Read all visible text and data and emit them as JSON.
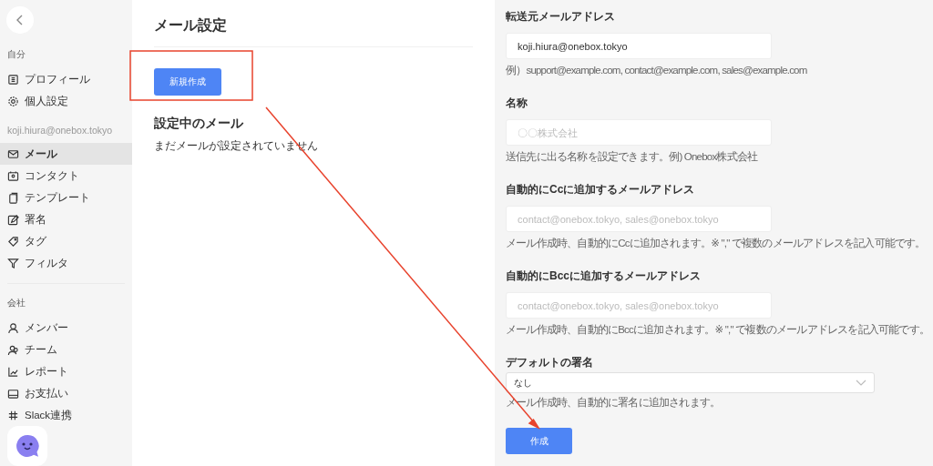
{
  "sidebar": {
    "sections": [
      {
        "heading": "自分",
        "items": [
          {
            "label": "プロフィール",
            "selected": false
          },
          {
            "label": "個人設定",
            "selected": false
          }
        ]
      },
      {
        "heading": "koji.hiura@onebox.tokyo",
        "items": [
          {
            "label": "メール",
            "selected": true
          },
          {
            "label": "コンタクト",
            "selected": false
          },
          {
            "label": "テンプレート",
            "selected": false
          },
          {
            "label": "署名",
            "selected": false
          },
          {
            "label": "タグ",
            "selected": false
          },
          {
            "label": "フィルタ",
            "selected": false
          }
        ]
      },
      {
        "heading": "会社",
        "items": [
          {
            "label": "メンバー",
            "selected": false
          },
          {
            "label": "チーム",
            "selected": false
          },
          {
            "label": "レポート",
            "selected": false
          },
          {
            "label": "お支払い",
            "selected": false
          },
          {
            "label": "Slack連携",
            "selected": false
          }
        ]
      }
    ]
  },
  "main": {
    "title": "メール設定",
    "new_button": "新規作成",
    "section_title": "設定中のメール",
    "empty_message": "まだメールが設定されていません"
  },
  "form": {
    "fields": [
      {
        "kind": "input",
        "label": "転送元メールアドレス",
        "value": "koji.hiura@onebox.tokyo",
        "hint": "例）support@example.com, contact@example.com, sales@example.com"
      },
      {
        "kind": "input",
        "label": "名称",
        "placeholder": "〇〇株式会社",
        "hint": "送信先に出る名称を設定できます。例) Onebox株式会社"
      },
      {
        "kind": "input",
        "label": "自動的にCcに追加するメールアドレス",
        "placeholder": "contact@onebox.tokyo, sales@onebox.tokyo",
        "hint": "メール作成時、自動的にCcに追加されます。※ \",\" で複数のメールアドレスを記入可能です。"
      },
      {
        "kind": "input",
        "label": "自動的にBccに追加するメールアドレス",
        "placeholder": "contact@onebox.tokyo, sales@onebox.tokyo",
        "hint": "メール作成時、自動的にBccに追加されます。※ \",\" で複数のメールアドレスを記入可能です。"
      },
      {
        "kind": "select",
        "label": "デフォルトの署名",
        "value": "なし",
        "hint": "メール作成時、自動的に署名に追加されます。"
      }
    ],
    "submit": "作成"
  }
}
